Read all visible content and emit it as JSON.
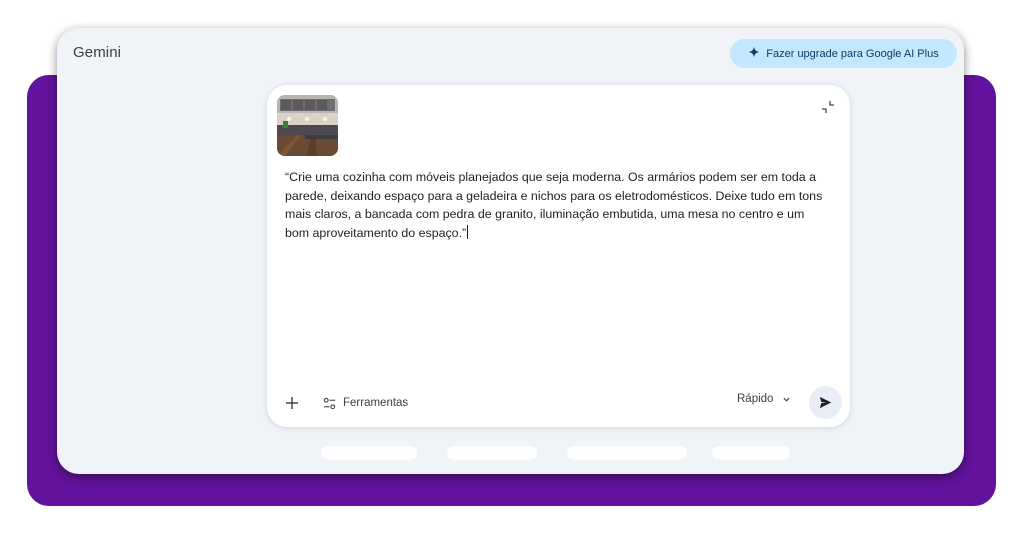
{
  "app": {
    "title": "Gemini"
  },
  "header": {
    "upgrade_label": "Fazer upgrade para Google AI Plus",
    "upgrade_icon": "sparkle-icon"
  },
  "composer": {
    "attachment": {
      "kind": "image",
      "subject": "modern-kitchen-thumbnail"
    },
    "prompt_text": "“Crie uma cozinha com móveis planejados que seja moderna. Os armários podem ser em toda a parede, deixando espaço para a geladeira e nichos para os eletrodomésticos. Deixe tudo em tons mais claros, a bancada com pedra de granito, iluminação embutida, uma mesa no centro e um bom aproveitamento do espaço.”",
    "tools_label": "Ferramentas",
    "model_label": "Rápido",
    "icons": {
      "add": "plus-icon",
      "tools": "tune-icon",
      "dropdown": "chevron-down-icon",
      "send": "send-icon",
      "collapse": "collapse-icon"
    }
  },
  "colors": {
    "backdrop": "#62129c",
    "window_bg": "#f0f4f9",
    "upgrade_bg": "#c2e7ff",
    "upgrade_text": "#0b3d66",
    "send_bg": "#e9eef6"
  }
}
